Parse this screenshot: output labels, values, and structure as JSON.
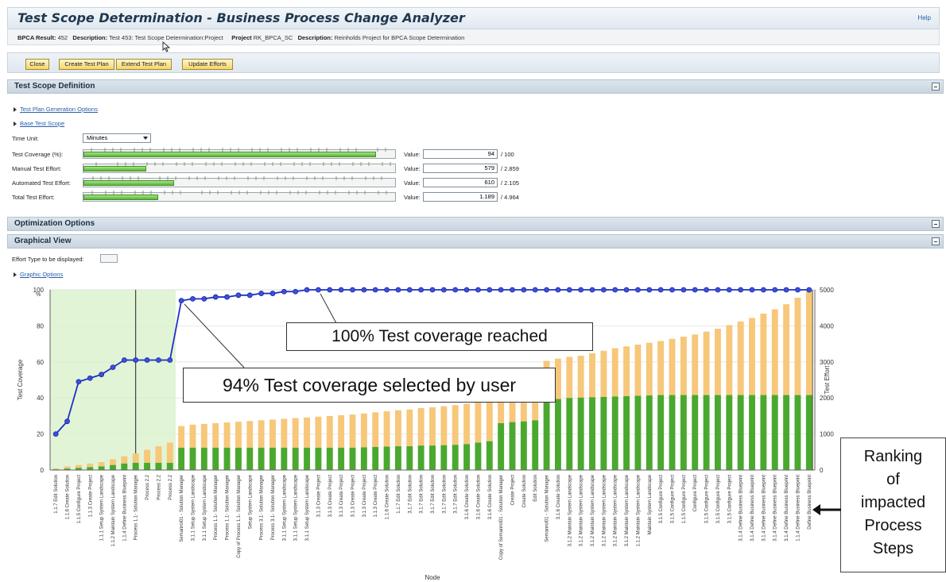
{
  "header": {
    "title": "Test Scope Determination - Business Process Change Analyzer",
    "help": "Help"
  },
  "info": {
    "bpca_label": "BPCA Result:",
    "bpca_value": "452",
    "desc_label": "Description:",
    "desc_value": "Test 453: Test Scope Determination:Project",
    "project_label": "Project",
    "project_value": "RK_BPCA_SC",
    "desc2_label": "Description:",
    "desc2_value": "Reinholds Project for BPCA Scope Determination"
  },
  "toolbar": {
    "close": "Close",
    "create": "Create Test Plan",
    "extend": "Extend Test Plan",
    "update": "Update Efforts"
  },
  "sections": {
    "definition": "Test Scope Definition",
    "optimization": "Optimization Options",
    "graphical": "Graphical View"
  },
  "definition": {
    "link_generation": "Test Plan Generation Options",
    "link_base": "Base Test Scope",
    "time_unit_label": "Time Unit:",
    "time_unit_value": "Minutes",
    "value_label": "Value:",
    "rows": [
      {
        "label": "Test Coverage (%):",
        "value": "94",
        "max": "/ 100",
        "fill": 0.94
      },
      {
        "label": "Manual Test Effort:",
        "value": "579",
        "max": "/ 2.859",
        "fill": 0.2025
      },
      {
        "label": "Automated Test Effort:",
        "value": "610",
        "max": "/ 2.105",
        "fill": 0.2898
      },
      {
        "label": "Total Test Effort:",
        "value": "1.189",
        "max": "/ 4.964",
        "fill": 0.2395
      }
    ]
  },
  "graphical": {
    "effort_label": "Effort Type to be displayed:",
    "graphic_options": "Graphic Options"
  },
  "callouts": {
    "reached": "100% Test coverage reached",
    "selected": "94% Test coverage selected by user"
  },
  "sidebox": {
    "lines": [
      "Ranking",
      "of",
      "impacted",
      "Process",
      "Steps"
    ]
  },
  "colors": {
    "line": "#1f2fc8",
    "green": "#4aa82f",
    "orange": "#f7c77a",
    "fillarea": "#d9f1cc"
  },
  "chart_data": {
    "type": "bar",
    "xlabel": "Node",
    "ylabel": "Test Coverage",
    "y2label": "Test Effort",
    "ylim": [
      0,
      100
    ],
    "y2lim": [
      0,
      5000
    ],
    "yticks": [
      0,
      20,
      40,
      60,
      80,
      100
    ],
    "y2ticks": [
      0,
      1000,
      2000,
      3000,
      4000,
      5000
    ],
    "grid": true,
    "categories": [
      "1.1.7 Edit Solution",
      "1.1.6 Create Solution",
      "1.1.5 Configure Project",
      "1.1.3 Create Project",
      "1.1.1 Setup System Landscape",
      "1.1.2 Maintain System Landscape",
      "1.1.4 Define Business Blueprint",
      "Process 1.1- Solution Manager",
      "Process 2.2",
      "Process 2.2",
      "Process 2.2",
      "Semanrol01 - Solution Manager",
      "3.1.1 Setup System Landscape",
      "3.1.1 Setup System Landscape",
      "Process 1.1- Solution Manager",
      "Process 1.1- Solution Manager",
      "Copy of Process 1.1- Solution Manager",
      "Setup System Landscape",
      "Process 3.1- Solution Manager",
      "Process 3.1- Solution Manager",
      "3.1.1 Setup System Landscape",
      "3.1.1 Setup System Landscape",
      "3.1.1 Setup System Landscape",
      "3.1.3 Create Project",
      "3.1.3 Create Project",
      "3.1.3 Create Project",
      "3.1.3 Create Project",
      "3.1.3 Create Project",
      "1.1.3 Create Project",
      "1.1.6 Create Solution",
      "1.1.7 Edit Solution",
      "3.1.7 Edit Solution",
      "3.1.7 Edit Solution",
      "3.1.7 Edit Solution",
      "3.1.7 Edit Solution",
      "3.1.7 Edit Solution",
      "3.1.6 Create Solution",
      "3.1.6 Create Solution",
      "3.1.6 Create Solution",
      "Copy of Semanrol01 - Solution Manager",
      "Create Project",
      "Create Solution",
      "Edit Solution",
      "Semanrol01 - Solution Manager",
      "3.1.6 Create Solution",
      "3.1.2 Maintain System Landscape",
      "3.1.2 Maintain System Landscape",
      "3.1.2 Maintain System Landscape",
      "3.1.2 Maintain System Landscape",
      "3.1.2 Maintain System Landscape",
      "3.1.2 Maintain System Landscape",
      "1.1.2 Maintain System Landscape",
      "Maintain System Landscape",
      "3.1.5 Configure Project",
      "3.1.5 Configure Project",
      "1.1.5 Configure Project",
      "Configure Project",
      "3.1.5 Configure Project",
      "3.1.5 Configure Project",
      "3.1.5 Configure Project",
      "3.1.4 Define Business Blueprint",
      "3.1.4 Define Business Blueprint",
      "3.1.4 Define Business Blueprint",
      "3.1.4 Define Business Blueprint",
      "3.1.4 Define Business Blueprint",
      "1.1.4 Define Business Blueprint",
      "Define Business Blueprint"
    ],
    "series": [
      {
        "name": "Test Coverage",
        "type": "line",
        "axis": "left",
        "values": [
          20,
          27,
          49,
          51,
          53,
          57,
          61,
          61,
          61,
          61,
          61,
          94,
          95,
          95,
          96,
          96,
          97,
          97,
          98,
          98,
          99,
          99,
          100,
          100,
          100,
          100,
          100,
          100,
          100,
          100,
          100,
          100,
          100,
          100,
          100,
          100,
          100,
          100,
          100,
          100,
          100,
          100,
          100,
          100,
          100,
          100,
          100,
          100,
          100,
          100,
          100,
          100,
          100,
          100,
          100,
          100,
          100,
          100,
          100,
          100,
          100,
          100,
          100,
          100,
          100,
          100,
          100
        ]
      },
      {
        "name": "Automated Test Effort",
        "type": "bar",
        "axis": "right",
        "values": [
          20,
          40,
          60,
          80,
          100,
          140,
          180,
          200,
          200,
          200,
          200,
          620,
          620,
          620,
          620,
          620,
          620,
          620,
          620,
          620,
          620,
          620,
          620,
          620,
          620,
          620,
          620,
          630,
          640,
          650,
          660,
          660,
          680,
          680,
          690,
          700,
          720,
          760,
          800,
          1300,
          1330,
          1350,
          1380,
          1930,
          1970,
          2000,
          2010,
          2020,
          2030,
          2040,
          2050,
          2060,
          2070,
          2080,
          2080,
          2080,
          2080,
          2080,
          2080,
          2080,
          2080,
          2080,
          2080,
          2080,
          2080,
          2080,
          2080
        ]
      },
      {
        "name": "Manual Test Effort",
        "type": "bar",
        "axis": "right",
        "values": [
          30,
          60,
          80,
          100,
          120,
          160,
          200,
          260,
          360,
          460,
          560,
          600,
          640,
          660,
          680,
          700,
          720,
          740,
          760,
          780,
          800,
          820,
          840,
          860,
          880,
          900,
          920,
          940,
          960,
          980,
          1000,
          1020,
          1040,
          1060,
          1080,
          1100,
          1120,
          1140,
          1160,
          1180,
          1200,
          1220,
          1240,
          1100,
          1120,
          1140,
          1160,
          1220,
          1280,
          1340,
          1380,
          1420,
          1460,
          1500,
          1560,
          1620,
          1680,
          1760,
          1840,
          1940,
          2040,
          2140,
          2260,
          2380,
          2520,
          2700,
          2880
        ]
      }
    ],
    "annotations": [
      "100% Test coverage reached",
      "94% Test coverage selected by user"
    ]
  }
}
